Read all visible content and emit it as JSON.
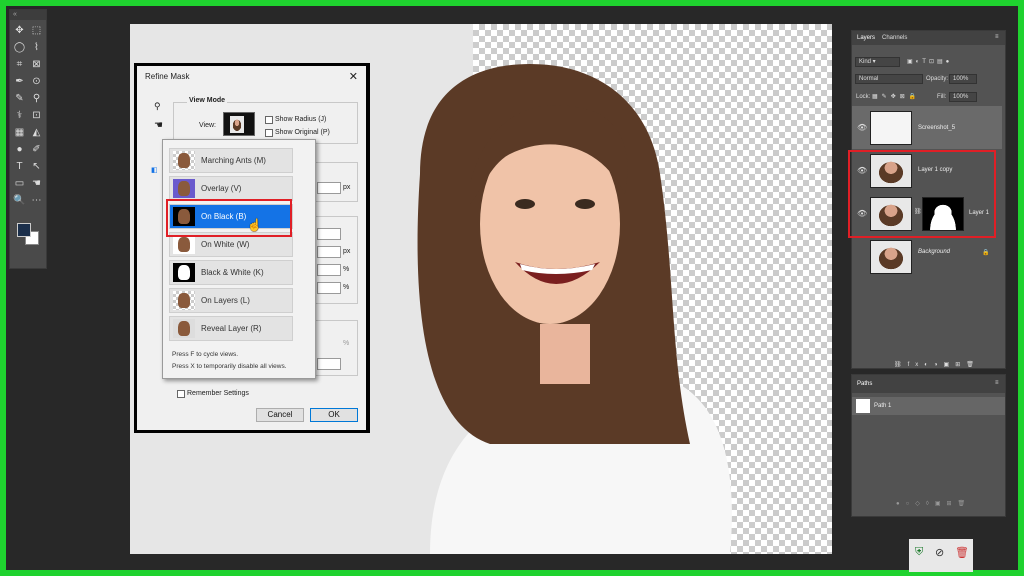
{
  "toolbar": {
    "grip": "«",
    "close": "✕",
    "tools": [
      "✥",
      "⬚",
      "◯",
      "⌇",
      "⌗",
      "⊠",
      "✒",
      "⊙",
      "✎",
      "⚲",
      "⚕",
      "⊡",
      "▦",
      "◭",
      "●",
      "✐",
      "T",
      "↖",
      "▭",
      "☚",
      "🔍",
      "⋯"
    ]
  },
  "dialog": {
    "title": "Refine Mask",
    "close": "✕",
    "view_mode": "View Mode",
    "view_label": "View:",
    "show_radius": "Show Radius (J)",
    "show_original": "Show Original (P)",
    "px1": "px",
    "px2": "px",
    "pct1": "%",
    "pct2": "%",
    "pct3": "%",
    "remember": "Remember Settings",
    "cancel": "Cancel",
    "ok": "OK"
  },
  "views": {
    "items": [
      {
        "label": "Marching Ants (M)",
        "selected": false
      },
      {
        "label": "Overlay (V)",
        "selected": false
      },
      {
        "label": "On Black (B)",
        "selected": true
      },
      {
        "label": "On White (W)",
        "selected": false
      },
      {
        "label": "Black & White (K)",
        "selected": false
      },
      {
        "label": "On Layers (L)",
        "selected": false
      },
      {
        "label": "Reveal Layer (R)",
        "selected": false
      }
    ],
    "hint1": "Press F to cycle views.",
    "hint2": "Press X to temporarily disable all views."
  },
  "layers_panel": {
    "tabs": [
      "Layers",
      "Channels"
    ],
    "kind": "Kind",
    "blend": "Normal",
    "opacity_label": "Opacity:",
    "opacity": "100%",
    "lock_label": "Lock:",
    "fill_label": "Fill:",
    "fill": "100%",
    "layers": [
      {
        "name": "Screenshot_5"
      },
      {
        "name": "Layer 1 copy"
      },
      {
        "name": "Layer 1"
      },
      {
        "name": "Background"
      }
    ]
  },
  "paths_panel": {
    "tab": "Paths",
    "path": "Path 1"
  },
  "colors": {
    "accent": "#1473e6",
    "highlight": "#e01f26",
    "frame": "#1fd22f"
  }
}
